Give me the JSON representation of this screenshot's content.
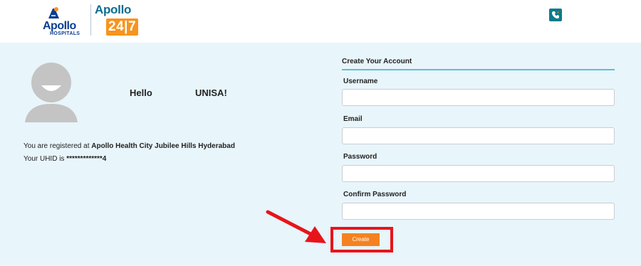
{
  "header": {
    "brand_apollo": "Apollo",
    "brand_hospitals": "HOSPITALS",
    "brand_247_word": "Apollo",
    "brand_247_num": "24|7",
    "phone_icon": "phone-icon"
  },
  "profile": {
    "hello": "Hello",
    "name": "UNISA!",
    "registered_prefix": "You are registered at ",
    "registered_location": "Apollo Health City Jubilee Hills Hyderabad",
    "uhid_prefix": "Your UHID is ",
    "uhid_value": "*************4"
  },
  "form": {
    "title": "Create Your Account",
    "fields": [
      {
        "label": "Username",
        "value": "",
        "placeholder": ""
      },
      {
        "label": "Email",
        "value": "",
        "placeholder": ""
      },
      {
        "label": "Password",
        "value": "",
        "placeholder": ""
      },
      {
        "label": "Confirm Password",
        "value": "",
        "placeholder": ""
      }
    ],
    "submit_label": "Create"
  },
  "colors": {
    "background_panel": "#e8f5fb",
    "accent_orange": "#f58220",
    "highlight_red": "#e8141b",
    "rule_teal": "#5fbfcf",
    "brand_blue": "#0b3d91"
  }
}
